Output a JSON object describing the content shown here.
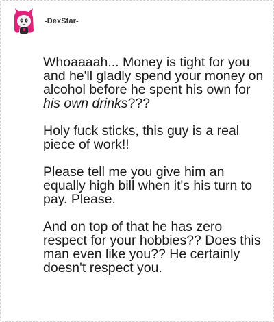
{
  "header": {
    "username": "-DexStar-",
    "avatar_icon": "avatar-cartoon-icon"
  },
  "post": {
    "para1_before": "Whoaaaah... Money is tight for you and he'll gladly spend your money on alcohol before he spent his own for ",
    "para1_italic": "his own drinks",
    "para1_after": "???",
    "para2": "Holy fuck sticks, this guy is a real piece of work!!",
    "para3": "Please tell me you give him an equally high bill when it's his turn to pay. Please.",
    "para4": "And on top of that he has zero respect for your hobbies?? Does this man even like you?? He certainly doesn't respect you."
  },
  "colors": {
    "avatar_primary": "#e0217a",
    "avatar_secondary": "#2b2b2b",
    "text": "#1a1a1a",
    "border": "#cfcfcf"
  }
}
